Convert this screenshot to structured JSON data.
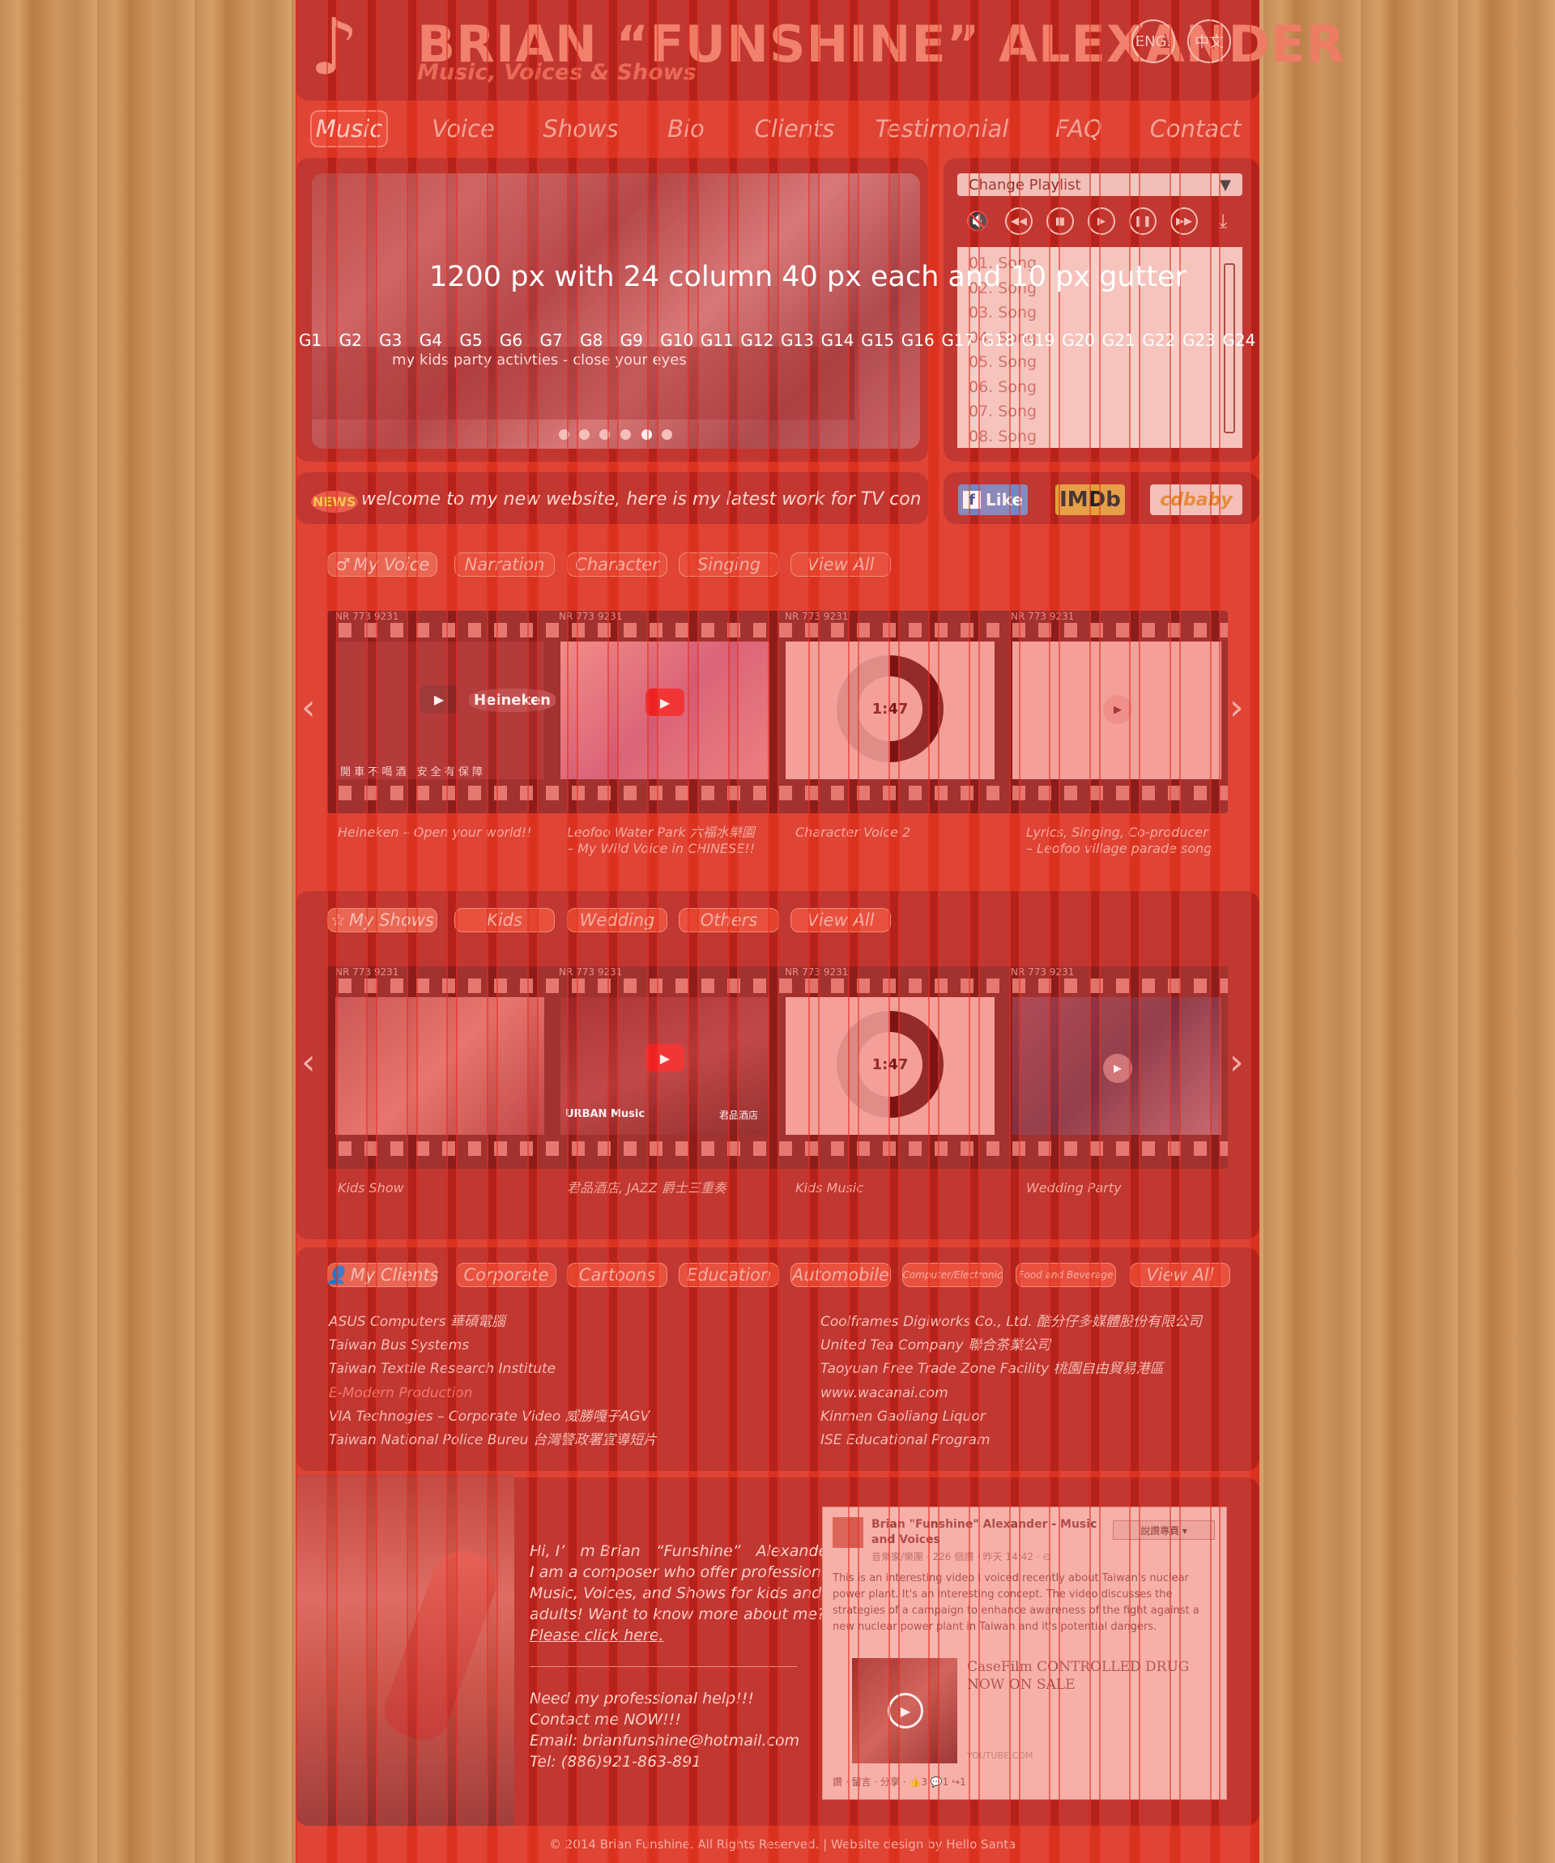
{
  "header": {
    "brand": "BRIAN “FUNSHINE” ALEXANDER",
    "tagline": "Music, Voices & Shows",
    "lang_en": "ENG.",
    "lang_zh": "中文",
    "logo_icon": "music-note-icon"
  },
  "nav": [
    "Music",
    "Voice",
    "Shows",
    "Bio",
    "Clients",
    "Testimonial",
    "FAQ",
    "Contact"
  ],
  "hero": {
    "caption": "my kids party activties - close your eyes",
    "overlay_title": "1200 px with 24 column 40 px each and 10 px gutter",
    "slide_count": 6,
    "active_slide": 5
  },
  "grid_labels": [
    "G1",
    "G2",
    "G3",
    "G4",
    "G5",
    "G6",
    "G7",
    "G8",
    "G9",
    "G10",
    "G11",
    "G12",
    "G13",
    "G14",
    "G15",
    "G16",
    "G17",
    "G18",
    "G19",
    "G20",
    "G21",
    "G22",
    "G23",
    "G24"
  ],
  "player": {
    "select": "Change Playlist",
    "songs": [
      "01. Song",
      "02. Song",
      "03. Song",
      "04. Song",
      "05. Song",
      "06. Song",
      "07. Song",
      "08. Song"
    ]
  },
  "news": {
    "badge": "NEWS",
    "text": "welcome to my new website, here is my latest work for TV commercial and"
  },
  "social": {
    "like": "Like",
    "imdb": "IMDb",
    "cdbaby": "cdbaby"
  },
  "voice": {
    "label": "My Voice",
    "tabs": [
      "Narration",
      "Character",
      "Singing",
      "View All"
    ],
    "frame_code": "NR 773 9231",
    "ring_time": "1:47",
    "thumb_text": "開 車 不 喝 酒　安 全 有 保 障",
    "brand_text": "Heineken",
    "captions": [
      "Heineken – Open your world!!",
      "Leofoo Water Park 六福水樂園\n– My Wild Voice in CHINESE!!",
      "Character Voice 2",
      "Lyrics, Singing, Co-producer\n– Leofoo village parade song"
    ]
  },
  "shows": {
    "label": "My Shows",
    "tabs": [
      "Kids",
      "Wedding",
      "Others",
      "View All"
    ],
    "frame_code": "NR 773 9231",
    "ring_time": "1:47",
    "thumb_text": "URBAN Music",
    "thumb_text2": "君品酒店",
    "captions": [
      "Kids Show",
      "君品酒店, JAZZ 爵士三重奏",
      "Kids Music",
      "Wedding Party"
    ]
  },
  "clients": {
    "label": "My Clients",
    "tabs": [
      "Corporate",
      "Cartoons",
      "Education",
      "Automobile",
      "Computer/Electronic",
      "Food and Beverage",
      "View All"
    ],
    "left": [
      "ASUS Computers 華碩電腦",
      "Taiwan Bus Systems",
      "Taiwan Textile Research Institute",
      "E-Modern Production",
      "VIA Technogies – Corporate Video 威勝嘎子AGV",
      "Taiwan National Police Bureu 台灣警政署宣導短片"
    ],
    "right": [
      "Coolframes Digiworks Co., Ltd. 酷分仔多媒體股份有限公司",
      "United Tea Company 聯合茶業公司",
      "Taoyuan Free Trade Zone Facility 桃園自由貿易港區",
      "www.wacanai.com",
      "Kinmen Gaoliang Liquor",
      "ISE Educational Program"
    ]
  },
  "bio": {
    "lines": [
      "Hi, I’　m Brian　“Funshine”　Alexander.",
      "I am a composer who offer professional",
      "Music, Voices, and Shows for kids and",
      "adults! Want to know more about me?",
      "Please click here."
    ],
    "contact": [
      "Need my professional help!!!",
      "Contact me NOW!!!",
      "Email: brianfunshine@hotmail.com",
      "Tel: (886)921-863-891"
    ]
  },
  "facebook": {
    "page": "Brian \"Funshine\" Alexander - Music and Voices",
    "meta": "音樂家/樂團 · 226 個讚 · 昨天 14:42 · ⊙",
    "button": "說讚專頁 ▾",
    "post": "This is an interesting video I voiced recently about Taiwan's nuclear power plant. It's an interesting concept. The video discusses the strategies of a campaign to enhance awareness of the fight against a new nuclear power plant in Taiwan and it's potential dangers.",
    "video_title": "CaseFilm CONTROLLED DRUG NOW ON SALE",
    "video_source": "YOUTUBE.COM",
    "actions": "讚 · 留言 · 分享 · 👍3 💬1 ↪1"
  },
  "footer": "© 2014 Brian Funshine. All Rights Reserved. | Website design by Hello Santa",
  "colors": {
    "page": "#d9331f",
    "panel": "#b4231b",
    "overlay": "#e6281e"
  }
}
